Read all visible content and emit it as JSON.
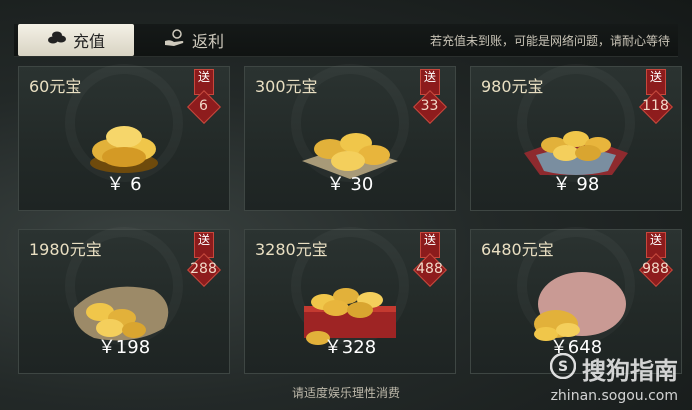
{
  "tabs": [
    {
      "label": "充值",
      "icon": "coins-icon",
      "active": true
    },
    {
      "label": "返利",
      "icon": "hand-coin-icon",
      "active": false
    }
  ],
  "notice": "若充值未到账，可能是网络问题，请耐心等待",
  "bonus_label": "送",
  "packages": [
    {
      "amount": "60元宝",
      "bonus": "6",
      "price": "￥  6"
    },
    {
      "amount": "300元宝",
      "bonus": "33",
      "price": "￥ 30"
    },
    {
      "amount": "980元宝",
      "bonus": "118",
      "price": "￥ 98"
    },
    {
      "amount": "1980元宝",
      "bonus": "288",
      "price": "￥198"
    },
    {
      "amount": "3280元宝",
      "bonus": "488",
      "price": "￥328"
    },
    {
      "amount": "6480元宝",
      "bonus": "988",
      "price": "￥648"
    }
  ],
  "footer": "请适度娱乐理性消费",
  "watermark": {
    "title": "搜狗指南",
    "url": "zhinan.sogou.com"
  },
  "colors": {
    "accent_red": "#8c1b1c",
    "gold": "#e2b13a",
    "card_bg": "#252c2a"
  }
}
